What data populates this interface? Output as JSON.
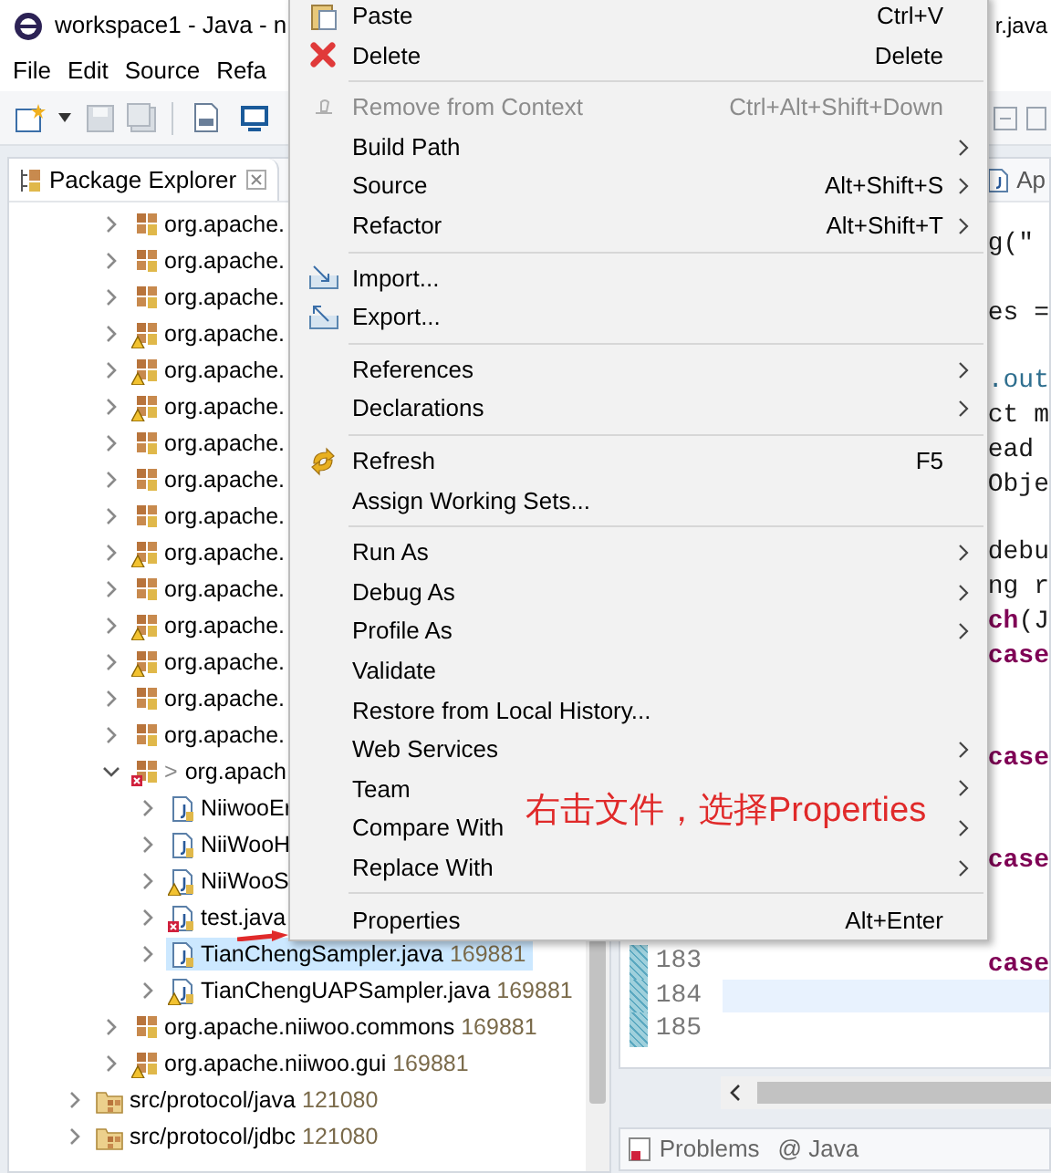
{
  "window": {
    "title": "workspace1 - Java - n",
    "title_end": "r.java"
  },
  "menu_bar": [
    "File",
    "Edit",
    "Source",
    "Refa"
  ],
  "package_explorer": {
    "title": "Package Explorer",
    "packages": [
      {
        "label": "org.apache.",
        "kind": "package",
        "warning": false,
        "error": false,
        "expanded": false,
        "selected": false
      },
      {
        "label": "org.apache.",
        "kind": "package",
        "warning": false,
        "error": false,
        "expanded": false,
        "selected": false
      },
      {
        "label": "org.apache.",
        "kind": "package",
        "warning": false,
        "error": false,
        "expanded": false,
        "selected": false
      },
      {
        "label": "org.apache.",
        "kind": "package",
        "warning": true,
        "error": false,
        "expanded": false,
        "selected": false
      },
      {
        "label": "org.apache.",
        "kind": "package",
        "warning": true,
        "error": false,
        "expanded": false,
        "selected": false
      },
      {
        "label": "org.apache.",
        "kind": "package",
        "warning": true,
        "error": false,
        "expanded": false,
        "selected": false
      },
      {
        "label": "org.apache.",
        "kind": "package",
        "warning": false,
        "error": false,
        "expanded": false,
        "selected": false
      },
      {
        "label": "org.apache.",
        "kind": "package",
        "warning": false,
        "error": false,
        "expanded": false,
        "selected": false
      },
      {
        "label": "org.apache.",
        "kind": "package",
        "warning": false,
        "error": false,
        "expanded": false,
        "selected": false
      },
      {
        "label": "org.apache.",
        "kind": "package",
        "warning": true,
        "error": false,
        "expanded": false,
        "selected": false
      },
      {
        "label": "org.apache.",
        "kind": "package",
        "warning": false,
        "error": false,
        "expanded": false,
        "selected": false
      },
      {
        "label": "org.apache.",
        "kind": "package",
        "warning": true,
        "error": false,
        "expanded": false,
        "selected": false
      },
      {
        "label": "org.apache.",
        "kind": "package",
        "warning": true,
        "error": false,
        "expanded": false,
        "selected": false
      },
      {
        "label": "org.apache.",
        "kind": "package",
        "warning": false,
        "error": false,
        "expanded": false,
        "selected": false
      },
      {
        "label": "org.apache.",
        "kind": "package",
        "warning": false,
        "error": false,
        "expanded": false,
        "selected": false
      },
      {
        "label": "org.apach",
        "marker": ">",
        "kind": "package",
        "warning": false,
        "error": true,
        "expanded": true,
        "selected": false,
        "children": [
          {
            "label": "NiiwooEr",
            "kind": "java_file",
            "warning": false,
            "error": false,
            "expanded": false,
            "selected": false
          },
          {
            "label": "NiiWooH",
            "kind": "java_file",
            "warning": false,
            "error": false,
            "expanded": false,
            "selected": false
          },
          {
            "label": "NiiWooS",
            "kind": "java_file",
            "warning": true,
            "error": false,
            "expanded": false,
            "selected": false
          },
          {
            "label": "test.java",
            "kind": "java_file",
            "warning": false,
            "error": true,
            "expanded": false,
            "selected": false
          },
          {
            "label": "TianChengSampler.java",
            "revision": "169881",
            "kind": "java_file",
            "warning": false,
            "error": false,
            "expanded": false,
            "selected": true
          },
          {
            "label": "TianChengUAPSampler.java",
            "revision": "169881",
            "kind": "java_file",
            "warning": true,
            "error": false,
            "expanded": false,
            "selected": false
          }
        ]
      },
      {
        "label": "org.apache.niiwoo.commons",
        "revision": "169881",
        "kind": "package",
        "warning": false,
        "error": false,
        "expanded": false,
        "selected": false
      },
      {
        "label": "org.apache.niiwoo.gui",
        "revision": "169881",
        "kind": "package",
        "warning": true,
        "error": false,
        "expanded": false,
        "selected": false
      }
    ],
    "source_folders": [
      {
        "label": "src/protocol/java",
        "revision": "121080",
        "kind": "source_folder",
        "expanded": false,
        "selected": false
      },
      {
        "label": "src/protocol/jdbc",
        "revision": "121080",
        "kind": "source_folder",
        "expanded": false,
        "selected": false
      }
    ]
  },
  "editor": {
    "tab": "Ap",
    "code": [
      {
        "text": "g(\"",
        "kind": "plain"
      },
      {
        "text": "es =",
        "kind": "plain"
      },
      {
        "text": ".out",
        "kind": "field"
      },
      {
        "text": "ct m",
        "kind": "plain"
      },
      {
        "text": "ead",
        "kind": "plain"
      },
      {
        "text": "Obje",
        "kind": "plain"
      },
      {
        "text": "debu",
        "kind": "plain"
      },
      {
        "text": "ng r",
        "kind": "plain"
      },
      {
        "text": "**ch**(J",
        "kind": "plain"
      },
      {
        "text": "case",
        "kind": "keyword"
      },
      {
        "text": "case",
        "kind": "keyword"
      },
      {
        "text": "case",
        "kind": "keyword"
      },
      {
        "text": "case",
        "kind": "keyword"
      }
    ],
    "line_numbers": [
      {
        "number": "183",
        "current": false
      },
      {
        "number": "184",
        "current": true
      },
      {
        "number": "185",
        "current": false
      }
    ]
  },
  "bottom_panel": {
    "tabs": [
      {
        "label": "Problems",
        "kind": "problems"
      },
      {
        "label": "@ Java",
        "kind": "plain"
      }
    ]
  },
  "context_menu": {
    "items": [
      {
        "kind": "item",
        "label": "Paste",
        "shortcut": "Ctrl+V",
        "submenu": false,
        "disabled": false
      },
      {
        "kind": "item",
        "label": "Delete",
        "shortcut": "Delete",
        "submenu": false,
        "disabled": false
      },
      {
        "kind": "separator"
      },
      {
        "kind": "item",
        "label": "Remove from Context",
        "shortcut": "Ctrl+Alt+Shift+Down",
        "submenu": false,
        "disabled": true
      },
      {
        "kind": "item",
        "label": "Build Path",
        "submenu": true,
        "disabled": false
      },
      {
        "kind": "item",
        "label": "Source",
        "shortcut": "Alt+Shift+S",
        "submenu": true,
        "disabled": false
      },
      {
        "kind": "item",
        "label": "Refactor",
        "shortcut": "Alt+Shift+T",
        "submenu": true,
        "disabled": false
      },
      {
        "kind": "separator"
      },
      {
        "kind": "item",
        "label": "Import...",
        "submenu": false,
        "disabled": false
      },
      {
        "kind": "item",
        "label": "Export...",
        "submenu": false,
        "disabled": false
      },
      {
        "kind": "separator"
      },
      {
        "kind": "item",
        "label": "References",
        "submenu": true,
        "disabled": false
      },
      {
        "kind": "item",
        "label": "Declarations",
        "submenu": true,
        "disabled": false
      },
      {
        "kind": "separator"
      },
      {
        "kind": "item",
        "label": "Refresh",
        "shortcut": "F5",
        "submenu": false,
        "disabled": false
      },
      {
        "kind": "item",
        "label": "Assign Working Sets...",
        "submenu": false,
        "disabled": false
      },
      {
        "kind": "separator"
      },
      {
        "kind": "item",
        "label": "Run As",
        "submenu": true,
        "disabled": false
      },
      {
        "kind": "item",
        "label": "Debug As",
        "submenu": true,
        "disabled": false
      },
      {
        "kind": "item",
        "label": "Profile As",
        "submenu": true,
        "disabled": false
      },
      {
        "kind": "item",
        "label": "Validate",
        "submenu": false,
        "disabled": false
      },
      {
        "kind": "item",
        "label": "Restore from Local History...",
        "submenu": false,
        "disabled": false
      },
      {
        "kind": "item",
        "label": "Web Services",
        "submenu": true,
        "disabled": false
      },
      {
        "kind": "item",
        "label": "Team",
        "submenu": true,
        "disabled": false
      },
      {
        "kind": "item",
        "label": "Compare With",
        "submenu": true,
        "disabled": false
      },
      {
        "kind": "item",
        "label": "Replace With",
        "submenu": true,
        "disabled": false
      },
      {
        "kind": "separator"
      },
      {
        "kind": "item",
        "label": "Properties",
        "shortcut": "Alt+Enter",
        "submenu": false,
        "disabled": false
      }
    ]
  },
  "annotation": {
    "text": "右击文件，选择Properties"
  }
}
